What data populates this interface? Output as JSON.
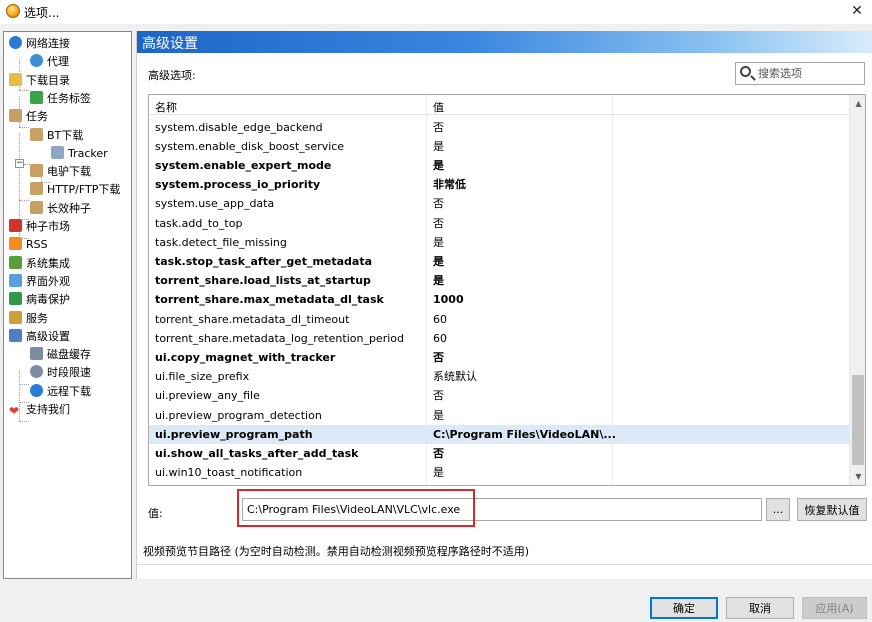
{
  "window": {
    "title": "选项..."
  },
  "tree": {
    "items": [
      {
        "label": "网络连接",
        "icon": "globe-icon",
        "color": "#2a7bd6"
      },
      {
        "label": "代理",
        "icon": "globe-small-icon",
        "color": "#3a8fd6"
      },
      {
        "label": "下载目录",
        "icon": "folder-icon",
        "color": "#e9b949"
      },
      {
        "label": "任务标签",
        "icon": "tag-icon",
        "color": "#3aa34a"
      },
      {
        "label": "任务",
        "icon": "clipboard-icon",
        "color": "#c9a063"
      },
      {
        "label": "BT下载",
        "icon": "clipboard-icon",
        "color": "#c9a063"
      },
      {
        "label": "Tracker",
        "icon": "cube-icon",
        "color": "#8fa7c4"
      },
      {
        "label": "电驴下载",
        "icon": "clipboard-icon",
        "color": "#c9a063"
      },
      {
        "label": "HTTP/FTP下载",
        "icon": "clipboard-icon",
        "color": "#c9a063"
      },
      {
        "label": "长效种子",
        "icon": "clipboard-icon",
        "color": "#c9a063"
      },
      {
        "label": "种子市场",
        "icon": "magnet-icon",
        "color": "#d0342c"
      },
      {
        "label": "RSS",
        "icon": "rss-icon",
        "color": "#f28c1c"
      },
      {
        "label": "系统集成",
        "icon": "puzzle-icon",
        "color": "#5a9e3a"
      },
      {
        "label": "界面外观",
        "icon": "palette-icon",
        "color": "#5aa0d8"
      },
      {
        "label": "病毒保护",
        "icon": "shield-icon",
        "color": "#2e9a4a"
      },
      {
        "label": "服务",
        "icon": "key-icon",
        "color": "#c8a03c"
      },
      {
        "label": "高级设置",
        "icon": "settings-window-icon",
        "color": "#4a7fc0"
      },
      {
        "label": "磁盘缓存",
        "icon": "disk-icon",
        "color": "#7d8ca0"
      },
      {
        "label": "时段限速",
        "icon": "clock-icon",
        "color": "#7d8ca0"
      },
      {
        "label": "远程下载",
        "icon": "remote-globe-icon",
        "color": "#2a7bd6"
      },
      {
        "label": "支持我们",
        "icon": "heart-icon",
        "color": "#e23b3b"
      }
    ]
  },
  "panel": {
    "header": "高级设置",
    "options_label": "高级选项:",
    "search_placeholder": "搜索选项",
    "columns": {
      "name": "名称",
      "value": "值"
    },
    "rows": [
      {
        "name": "system.disable_edge_backend",
        "value": "否",
        "bold": false
      },
      {
        "name": "system.enable_disk_boost_service",
        "value": "是",
        "bold": false
      },
      {
        "name": "system.enable_expert_mode",
        "value": "是",
        "bold": true
      },
      {
        "name": "system.process_io_priority",
        "value": "非常低",
        "bold": true
      },
      {
        "name": "system.use_app_data",
        "value": "否",
        "bold": false
      },
      {
        "name": "task.add_to_top",
        "value": "否",
        "bold": false
      },
      {
        "name": "task.detect_file_missing",
        "value": "是",
        "bold": false
      },
      {
        "name": "task.stop_task_after_get_metadata",
        "value": "是",
        "bold": true
      },
      {
        "name": "torrent_share.load_lists_at_startup",
        "value": "是",
        "bold": true
      },
      {
        "name": "torrent_share.max_metadata_dl_task",
        "value": "1000",
        "bold": true
      },
      {
        "name": "torrent_share.metadata_dl_timeout",
        "value": "60",
        "bold": false
      },
      {
        "name": "torrent_share.metadata_log_retention_period",
        "value": "60",
        "bold": false
      },
      {
        "name": "ui.copy_magnet_with_tracker",
        "value": "否",
        "bold": true
      },
      {
        "name": "ui.file_size_prefix",
        "value": "系统默认",
        "bold": false
      },
      {
        "name": "ui.preview_any_file",
        "value": "否",
        "bold": false
      },
      {
        "name": "ui.preview_program_detection",
        "value": "是",
        "bold": false
      },
      {
        "name": "ui.preview_program_path",
        "value": "C:\\Program Files\\VideoLAN\\...",
        "bold": true,
        "selected": true
      },
      {
        "name": "ui.show_all_tasks_after_add_task",
        "value": "否",
        "bold": true
      },
      {
        "name": "ui.win10_toast_notification",
        "value": "是",
        "bold": false
      }
    ],
    "value_label": "值:",
    "value_text": "C:\\Program Files\\VideoLAN\\VLC\\vlc.exe",
    "browse_label": "...",
    "reset_label": "恢复默认值",
    "description": "视频预览节目路径 (为空时自动检测。禁用自动检测视频预览程序路径时不适用)"
  },
  "buttons": {
    "ok": "确定",
    "cancel": "取消",
    "apply": "应用(A)"
  },
  "colors": {
    "header_gradient_start": "#1d65c9",
    "highlight_red": "#d9252b",
    "selection": "#dde9f7"
  }
}
